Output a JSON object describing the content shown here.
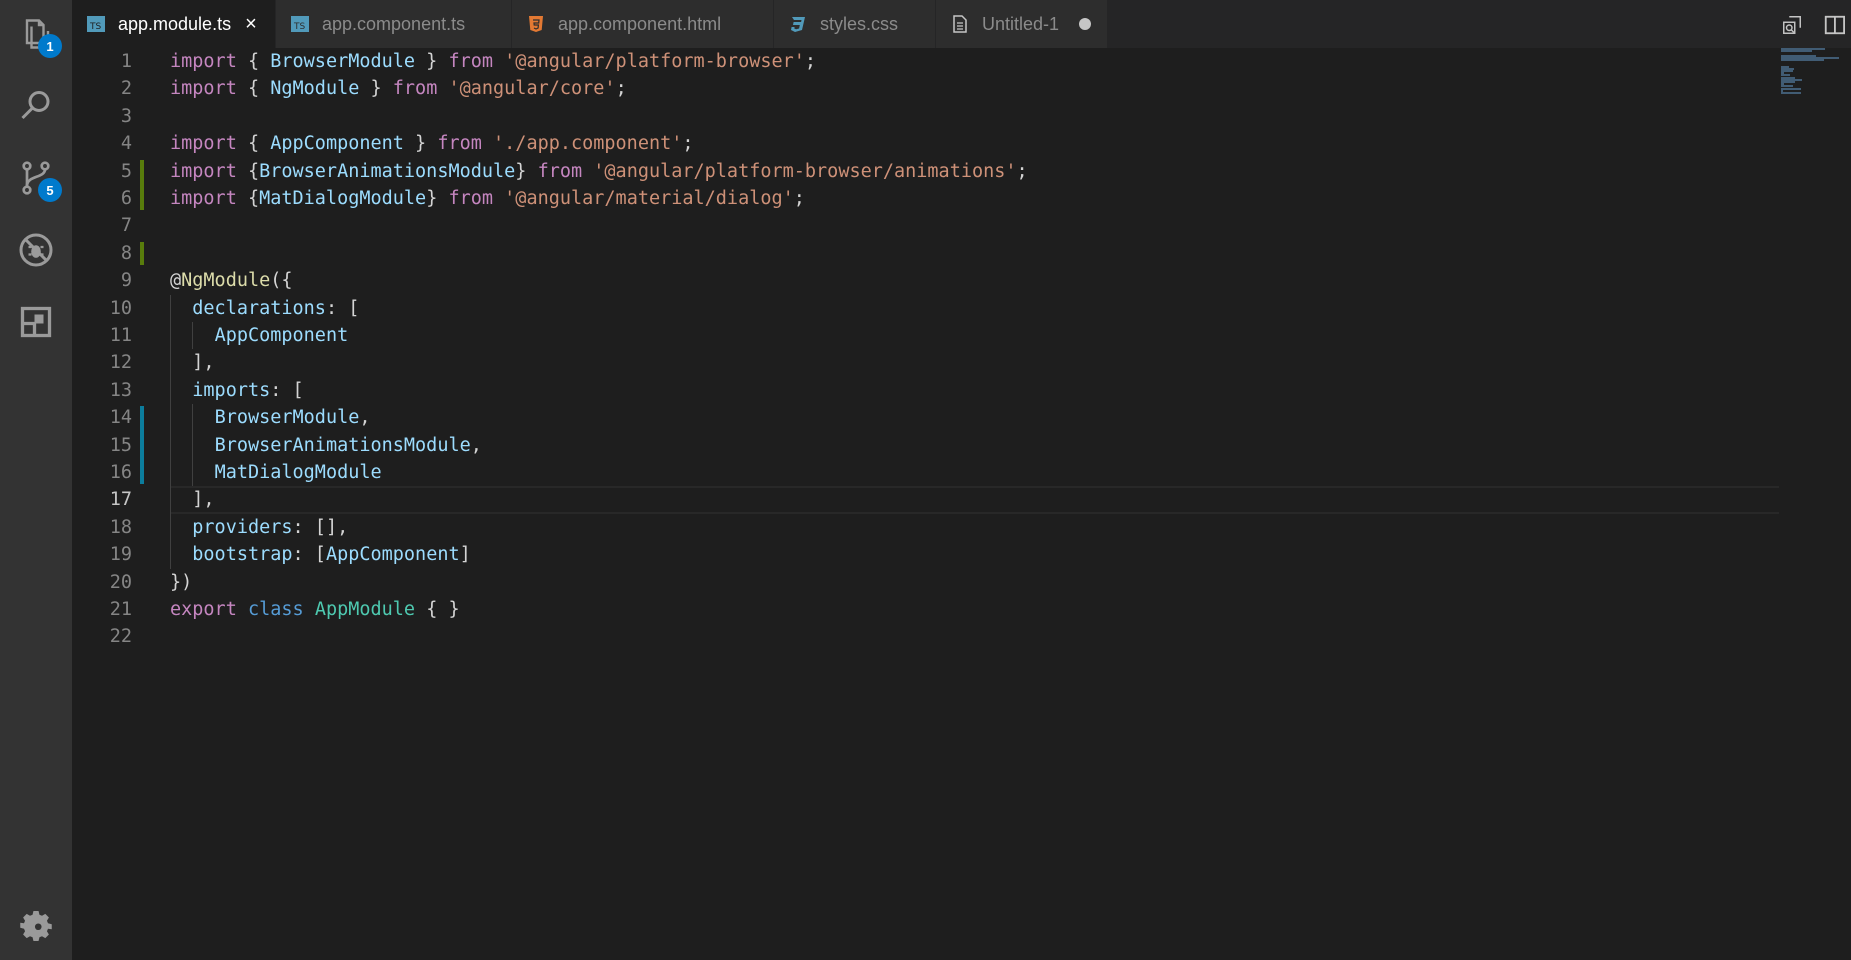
{
  "activity_bar": {
    "items": [
      {
        "name": "explorer-icon",
        "badge": "1"
      },
      {
        "name": "search-icon",
        "badge": null
      },
      {
        "name": "source-control-icon",
        "badge": "5"
      },
      {
        "name": "debug-icon",
        "badge": null
      },
      {
        "name": "extensions-icon",
        "badge": null
      }
    ],
    "bottom": {
      "name": "gear-icon"
    }
  },
  "tabs": [
    {
      "label": "app.module.ts",
      "icon": "typescript-file-icon",
      "active": true,
      "close": "×"
    },
    {
      "label": "app.component.ts",
      "icon": "typescript-file-icon",
      "active": false
    },
    {
      "label": "app.component.html",
      "icon": "html-file-icon",
      "active": false
    },
    {
      "label": "styles.css",
      "icon": "css-file-icon",
      "active": false
    },
    {
      "label": "Untitled-1",
      "icon": "file-icon",
      "active": false,
      "dirty": true
    }
  ],
  "editor": {
    "current_line": 17,
    "line_numbers": [
      "1",
      "2",
      "3",
      "4",
      "5",
      "6",
      "7",
      "8",
      "9",
      "10",
      "11",
      "12",
      "13",
      "14",
      "15",
      "16",
      "17",
      "18",
      "19",
      "20",
      "21",
      "22"
    ],
    "lines": [
      [
        [
          "kw",
          "import"
        ],
        [
          "p",
          " { "
        ],
        [
          "var",
          "BrowserModule"
        ],
        [
          "p",
          " } "
        ],
        [
          "kw",
          "from"
        ],
        [
          "p",
          " "
        ],
        [
          "str",
          "'@angular/platform-browser'"
        ],
        [
          "p",
          ";"
        ]
      ],
      [
        [
          "kw",
          "import"
        ],
        [
          "p",
          " { "
        ],
        [
          "var",
          "NgModule"
        ],
        [
          "p",
          " } "
        ],
        [
          "kw",
          "from"
        ],
        [
          "p",
          " "
        ],
        [
          "str",
          "'@angular/core'"
        ],
        [
          "p",
          ";"
        ]
      ],
      [],
      [
        [
          "kw",
          "import"
        ],
        [
          "p",
          " { "
        ],
        [
          "var",
          "AppComponent"
        ],
        [
          "p",
          " } "
        ],
        [
          "kw",
          "from"
        ],
        [
          "p",
          " "
        ],
        [
          "str",
          "'./app.component'"
        ],
        [
          "p",
          ";"
        ]
      ],
      [
        [
          "kw",
          "import"
        ],
        [
          "p",
          " {"
        ],
        [
          "var",
          "BrowserAnimationsModule"
        ],
        [
          "p",
          "} "
        ],
        [
          "kw",
          "from"
        ],
        [
          "p",
          " "
        ],
        [
          "str",
          "'@angular/platform-browser/animations'"
        ],
        [
          "p",
          ";"
        ]
      ],
      [
        [
          "kw",
          "import"
        ],
        [
          "p",
          " {"
        ],
        [
          "var",
          "MatDialogModule"
        ],
        [
          "p",
          "} "
        ],
        [
          "kw",
          "from"
        ],
        [
          "p",
          " "
        ],
        [
          "str",
          "'@angular/material/dialog'"
        ],
        [
          "p",
          ";"
        ]
      ],
      [],
      [],
      [
        [
          "p",
          "@"
        ],
        [
          "fn",
          "NgModule"
        ],
        [
          "p",
          "({"
        ]
      ],
      [
        [
          "p",
          "  "
        ],
        [
          "var",
          "declarations"
        ],
        [
          "p",
          ": ["
        ]
      ],
      [
        [
          "p",
          "    "
        ],
        [
          "var",
          "AppComponent"
        ]
      ],
      [
        [
          "p",
          "  ],"
        ]
      ],
      [
        [
          "p",
          "  "
        ],
        [
          "var",
          "imports"
        ],
        [
          "p",
          ": ["
        ]
      ],
      [
        [
          "p",
          "    "
        ],
        [
          "var",
          "BrowserModule"
        ],
        [
          "p",
          ","
        ]
      ],
      [
        [
          "p",
          "    "
        ],
        [
          "var",
          "BrowserAnimationsModule"
        ],
        [
          "p",
          ","
        ]
      ],
      [
        [
          "p",
          "    "
        ],
        [
          "var",
          "MatDialogModule"
        ]
      ],
      [
        [
          "p",
          "  ],"
        ]
      ],
      [
        [
          "p",
          "  "
        ],
        [
          "var",
          "providers"
        ],
        [
          "p",
          ": [],"
        ]
      ],
      [
        [
          "p",
          "  "
        ],
        [
          "var",
          "bootstrap"
        ],
        [
          "p",
          ": ["
        ],
        [
          "var",
          "AppComponent"
        ],
        [
          "p",
          "]"
        ]
      ],
      [
        [
          "p",
          "})"
        ]
      ],
      [
        [
          "kw",
          "export"
        ],
        [
          "p",
          " "
        ],
        [
          "kw2",
          "class"
        ],
        [
          "p",
          " "
        ],
        [
          "cls",
          "AppModule"
        ],
        [
          "p",
          " { }"
        ]
      ],
      []
    ]
  },
  "colors": {
    "keyword": "#c586c0",
    "storage": "#569cd6",
    "string": "#ce9178",
    "variable": "#9cdcfe",
    "class": "#4ec9b0",
    "decorator": "#dcdcaa",
    "added_marker": "#587c0c",
    "modified_marker": "#0c7d9d",
    "badge": "#007acc"
  }
}
